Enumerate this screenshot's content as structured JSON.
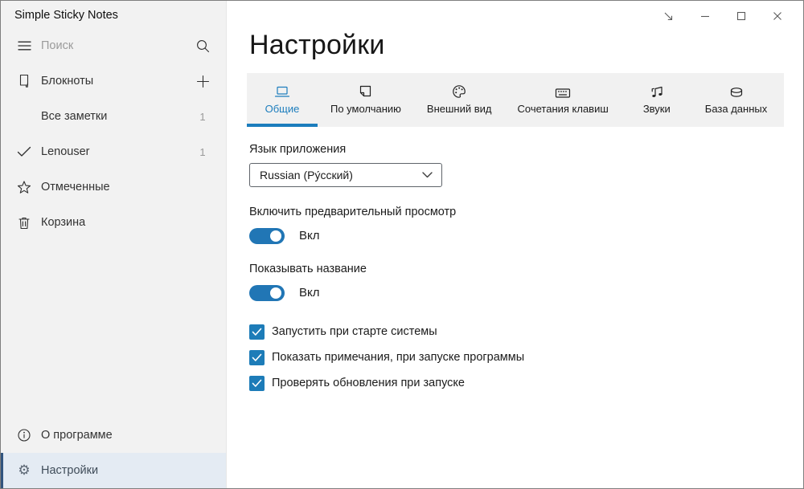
{
  "window": {
    "control_icons": [
      "move-to-corner-icon",
      "minimize-icon",
      "maximize-icon",
      "close-icon"
    ]
  },
  "sidebar": {
    "app_title": "Simple Sticky Notes",
    "search": {
      "placeholder": "Поиск",
      "icons": [
        "hamburger-icon",
        "search-icon"
      ]
    },
    "notebooks": {
      "label": "Блокноты",
      "icons": [
        "notebook-icon",
        "plus-icon"
      ]
    },
    "items": [
      {
        "label": "Все заметки",
        "count": "1",
        "icon": ""
      },
      {
        "label": "Lenouser",
        "count": "1",
        "icon": "check-icon"
      },
      {
        "label": "Отмеченные",
        "icon": "star-icon"
      },
      {
        "label": "Корзина",
        "icon": "trash-icon"
      }
    ],
    "footer": [
      {
        "label": "О программе",
        "icon": "info-icon",
        "selected": false
      },
      {
        "label": "Настройки",
        "icon": "gear-icon",
        "icon_glyph": "⚙",
        "selected": true
      }
    ]
  },
  "main": {
    "title": "Настройки",
    "tabs": [
      {
        "label": "Общие",
        "icon": "laptop-icon",
        "selected": true
      },
      {
        "label": "По умолчанию",
        "icon": "note-icon",
        "selected": false
      },
      {
        "label": "Внешний вид",
        "icon": "palette-icon",
        "selected": false
      },
      {
        "label": "Сочетания клавиш",
        "icon": "keyboard-icon",
        "selected": false
      },
      {
        "label": "Звуки",
        "icon": "music-notes-icon",
        "selected": false
      },
      {
        "label": "База данных",
        "icon": "database-icon",
        "selected": false
      }
    ],
    "language": {
      "label": "Язык приложения",
      "value": "Russian (Ру́сский)"
    },
    "toggles": [
      {
        "label": "Включить предварительный просмотр",
        "state_label": "Вкл",
        "on": true
      },
      {
        "label": "Показывать название",
        "state_label": "Вкл",
        "on": true
      }
    ],
    "checkboxes": [
      {
        "label": "Запустить при старте системы",
        "checked": true
      },
      {
        "label": "Показать примечания, при запуске программы",
        "checked": true
      },
      {
        "label": "Проверять обновления при запуске",
        "checked": true
      }
    ]
  },
  "colors": {
    "accent": "#1c7dbd",
    "sidebar_bg": "#f2f2f2",
    "tabstrip_bg": "#f1f1f1",
    "selected_row_bg": "#e4ebf3",
    "selected_row_accent": "#31547e"
  }
}
